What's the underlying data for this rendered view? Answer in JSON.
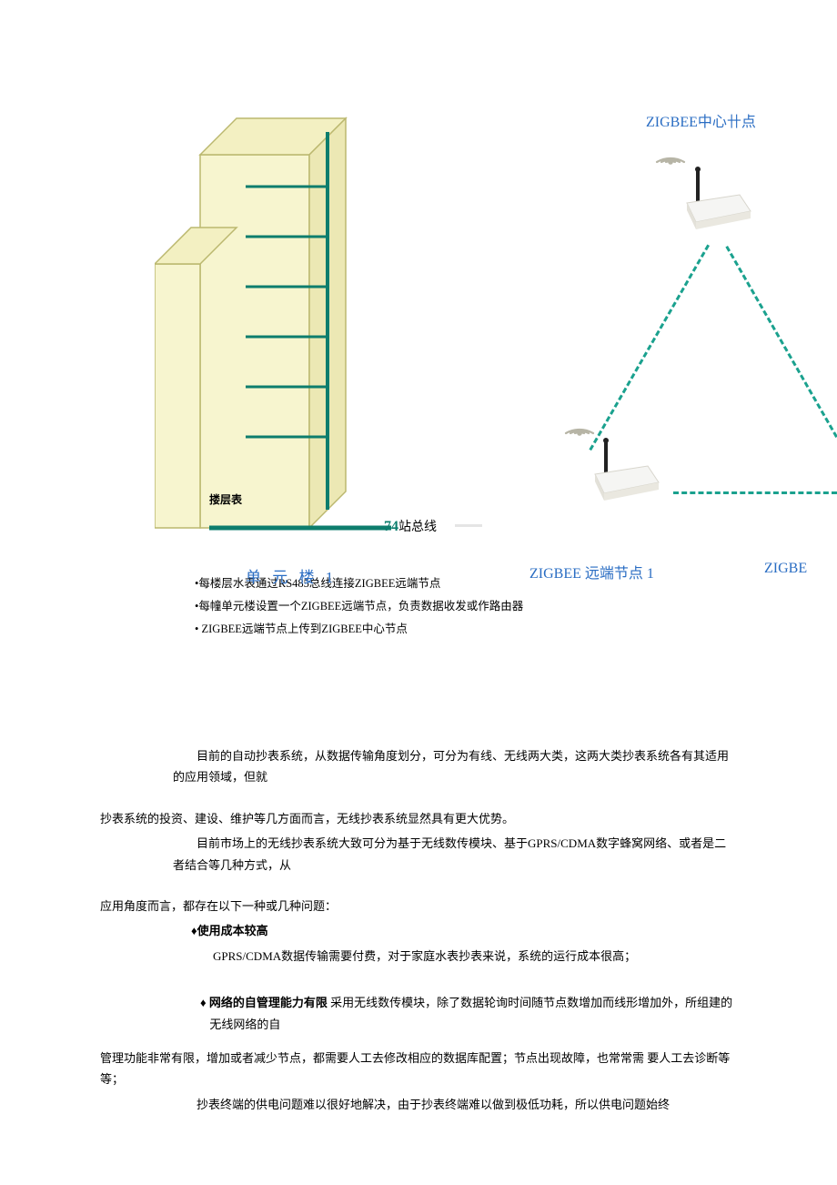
{
  "diagram": {
    "building_floor_label": "搂层表",
    "bus_number": "74",
    "bus_text": "站总线",
    "unit_building_label": "单 元 楼 1",
    "center_node_label": "ZIGBEE中心卄点",
    "remote_node_label_1": "ZIGBEE 远端节点 1",
    "remote_node_label_2": "ZIGBE"
  },
  "bullets": {
    "b1": "•每楼层水表通过RS485总线连接ZIGBEE远端节点",
    "b2": "•每幢单元楼设置一个ZIGBEE远端节点，负责数据收发或作路由器",
    "b3": "• ZIGBEE远端节点上传到ZIGBEE中心节点"
  },
  "body": {
    "p1": "目前的自动抄表系统，从数据传输角度划分，可分为有线、无线两大类，这两大类抄表系统各有其适用的应用领域，但就",
    "p2": "抄表系统的投资、建设、维护等几方面而言，无线抄表系统显然具有更大优势。",
    "p3": "目前市场上的无线抄表系统大致可分为基于无线数传模块、基于GPRS/CDMA数字蜂窝网络、或者是二者结合等几种方式，从",
    "p4": "应用角度而言，都存在以下一种或几种问题：",
    "p5_title": "♦使用成本较高",
    "p5_body": "GPRS/CDMA数据传输需要付费，对于家庭水表抄表来说，系统的运行成本很高；",
    "p6_title": "♦ 网络的自管理能力有限",
    "p6_body": " 采用无线数传模块，除了数据轮询时间随节点数增加而线形增加外，所组建的无线网络的自",
    "p7": "管理功能非常有限，增加或者减少节点，都需要人工去修改相应的数据库配置；节点出现故障，也常常需 要人工去诊断等等；",
    "p8": "抄表终端的供电问题难以很好地解决，由于抄表终端难以做到极低功耗，所以供电问题始终"
  }
}
